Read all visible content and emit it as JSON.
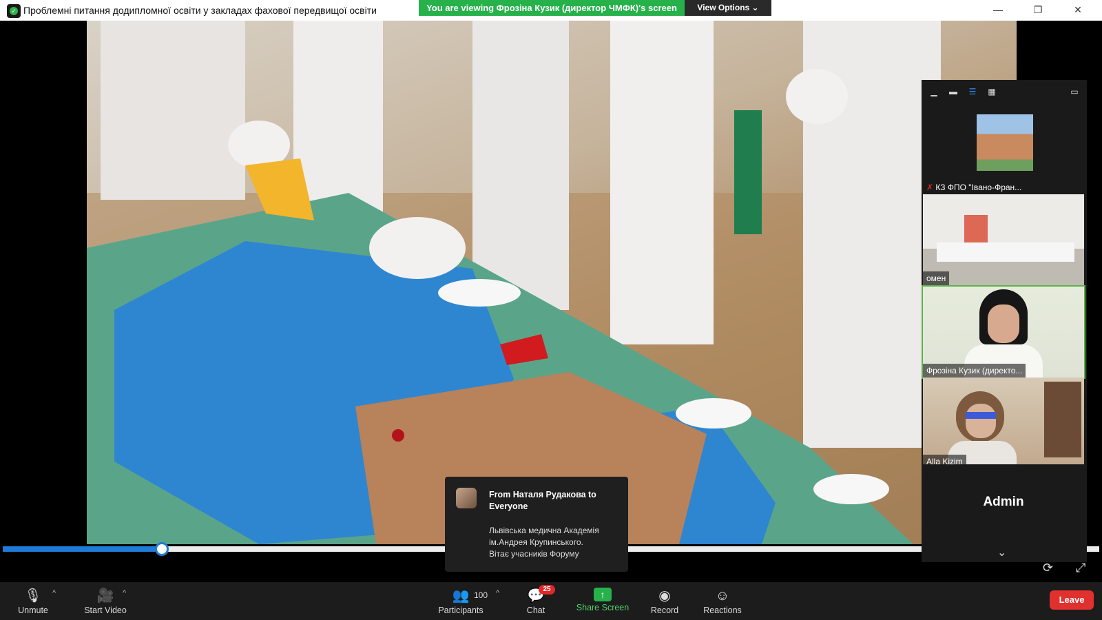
{
  "window": {
    "title": "Проблемні питання додипломної освіти  у закладах фахової передвищої освіти",
    "minimize_glyph": "—",
    "maximize_glyph": "❐",
    "close_glyph": "✕",
    "view_label": "View"
  },
  "sharing": {
    "banner": "You are viewing Фрозіна Кузик (директор ЧМФК)'s screen",
    "view_options": "View Options ⌄"
  },
  "video_progress": {
    "fraction": 0.145
  },
  "gallery": {
    "toolbar_icons": [
      "minimize-icon",
      "speaker-view-icon",
      "side-by-side-icon",
      "grid-view-icon",
      "exit-side-icon"
    ],
    "tiles": [
      {
        "name": "КЗ ФПО \"Івано-Фран...",
        "muted": true
      },
      {
        "name": "омен",
        "muted": false
      },
      {
        "name": "Фрозіна Кузик (директо...",
        "muted": false
      },
      {
        "name": "Alla Kizim",
        "muted": false
      }
    ],
    "admin_label": "Admin",
    "chevron": "⌄"
  },
  "chat_toast": {
    "from": "From Наталя Рудакова to Everyone",
    "message": "Львівська медична Академія\nім.Андрея Крупинського.\nВітає учасників Форуму"
  },
  "toolbar": {
    "unmute": "Unmute",
    "start_video": "Start Video",
    "participants": "Participants",
    "participant_count": "100",
    "chat": "Chat",
    "chat_badge": "25",
    "share_screen": "Share Screen",
    "record": "Record",
    "reactions": "Reactions",
    "leave": "Leave"
  },
  "colors": {
    "banner_green": "#26b14b",
    "progress_blue": "#1e7bd6",
    "leave_red": "#e0312f",
    "toolbar_bg": "#1c1c1c"
  }
}
